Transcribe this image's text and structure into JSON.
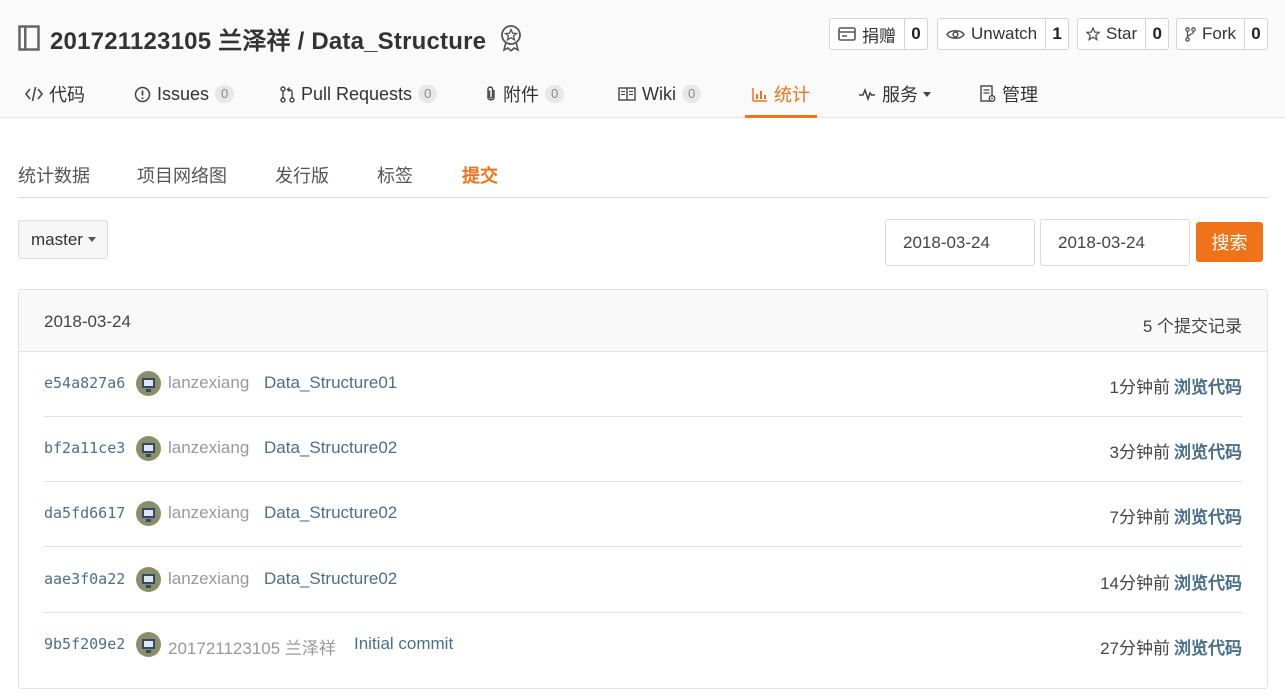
{
  "repo": {
    "title": "201721123105 兰泽祥 / Data_Structure",
    "icon": "repo-book-icon",
    "badge_icon": "award-badge-icon"
  },
  "actions": [
    {
      "label": "捐赠",
      "count": "0",
      "icon": "donate-icon"
    },
    {
      "label": "Unwatch",
      "count": "1",
      "icon": "eye-icon"
    },
    {
      "label": "Star",
      "count": "0",
      "icon": "star-icon"
    },
    {
      "label": "Fork",
      "count": "0",
      "icon": "fork-icon"
    }
  ],
  "nav": [
    {
      "label": "代码",
      "icon": "code-icon"
    },
    {
      "label": "Issues",
      "count": "0",
      "icon": "issue-icon"
    },
    {
      "label": "Pull Requests",
      "count": "0",
      "icon": "pull-request-icon"
    },
    {
      "label": "附件",
      "count": "0",
      "icon": "paperclip-icon"
    },
    {
      "label": "Wiki",
      "count": "0",
      "icon": "book-open-icon"
    },
    {
      "label": "统计",
      "icon": "bar-chart-icon",
      "active": true
    },
    {
      "label": "服务",
      "icon": "pulse-icon"
    },
    {
      "label": "管理",
      "icon": "settings-doc-icon"
    }
  ],
  "subnav": [
    {
      "label": "统计数据"
    },
    {
      "label": "项目网络图"
    },
    {
      "label": "发行版"
    },
    {
      "label": "标签"
    },
    {
      "label": "提交",
      "active": true
    }
  ],
  "filters": {
    "branch": "master",
    "date_from": "2018-03-24",
    "date_to": "2018-03-24",
    "search_label": "搜索"
  },
  "commits_panel": {
    "date": "2018-03-24",
    "count_label": "5 个提交记录",
    "rows": [
      {
        "sha": "e54a827a6",
        "author": "lanzexiang",
        "message": "Data_Structure01",
        "time": "1分钟前",
        "browse": "浏览代码"
      },
      {
        "sha": "bf2a11ce3",
        "author": "lanzexiang",
        "message": "Data_Structure02",
        "time": "3分钟前",
        "browse": "浏览代码"
      },
      {
        "sha": "da5fd6617",
        "author": "lanzexiang",
        "message": "Data_Structure02",
        "time": "7分钟前",
        "browse": "浏览代码"
      },
      {
        "sha": "aae3f0a22",
        "author": "lanzexiang",
        "message": "Data_Structure02",
        "time": "14分钟前",
        "browse": "浏览代码"
      },
      {
        "sha": "9b5f209e2",
        "author": "201721123105 兰泽祥",
        "message": "Initial commit",
        "time": "27分钟前",
        "browse": "浏览代码"
      }
    ]
  },
  "colors": {
    "accent": "#f0731a",
    "link": "#4a6f8a"
  }
}
